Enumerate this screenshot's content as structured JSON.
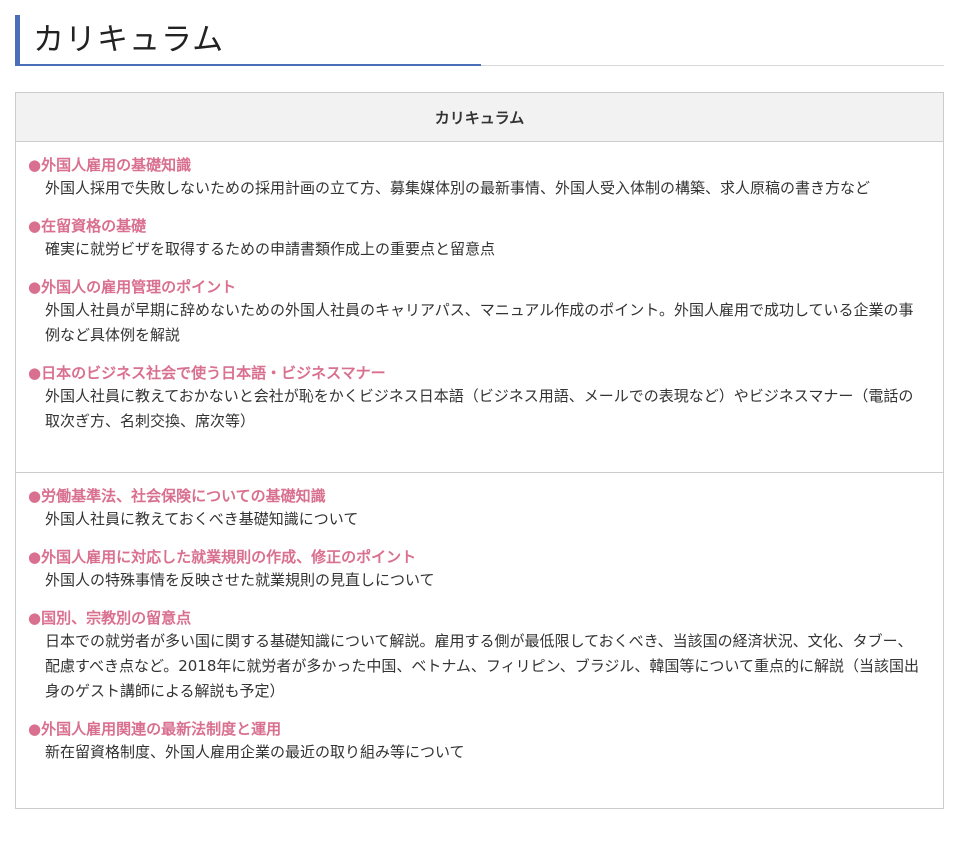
{
  "page": {
    "heading": "カリキュラム"
  },
  "table": {
    "header": "カリキュラム",
    "sections": [
      {
        "items": [
          {
            "title": "●外国人雇用の基礎知識",
            "description": "外国人採用で失敗しないための採用計画の立て方、募集媒体別の最新事情、外国人受入体制の構築、求人原稿の書き方など"
          },
          {
            "title": "●在留資格の基礎",
            "description": "確実に就労ビザを取得するための申請書類作成上の重要点と留意点"
          },
          {
            "title": "●外国人の雇用管理のポイント",
            "description": "外国人社員が早期に辞めないための外国人社員のキャリアパス、マニュアル作成のポイント。外国人雇用で成功している企業の事例など具体例を解説"
          },
          {
            "title": "●日本のビジネス社会で使う日本語・ビジネスマナー",
            "description": "外国人社員に教えておかないと会社が恥をかくビジネス日本語（ビジネス用語、メールでの表現など）やビジネスマナー（電話の取次ぎ方、名刺交換、席次等）"
          }
        ]
      },
      {
        "items": [
          {
            "title": "●労働基準法、社会保険についての基礎知識",
            "description": "外国人社員に教えておくべき基礎知識について"
          },
          {
            "title": "●外国人雇用に対応した就業規則の作成、修正のポイント",
            "description": "外国人の特殊事情を反映させた就業規則の見直しについて"
          },
          {
            "title": "●国別、宗教別の留意点",
            "description": "日本での就労者が多い国に関する基礎知識について解説。雇用する側が最低限しておくべき、当該国の経済状況、文化、タブー、配慮すべき点など。2018年に就労者が多かった中国、ベトナム、フィリピン、ブラジル、韓国等について重点的に解説（当該国出身のゲスト講師による解説も予定）"
          },
          {
            "title": "●外国人雇用関連の最新法制度と運用",
            "description": "新在留資格制度、外国人雇用企業の最近の取り組み等について"
          }
        ]
      }
    ]
  },
  "colors": {
    "accent_blue": "#4a6fb8",
    "item_title_pink": "#d9708f",
    "header_bg": "#f2f2f2",
    "border": "#cccccc"
  }
}
